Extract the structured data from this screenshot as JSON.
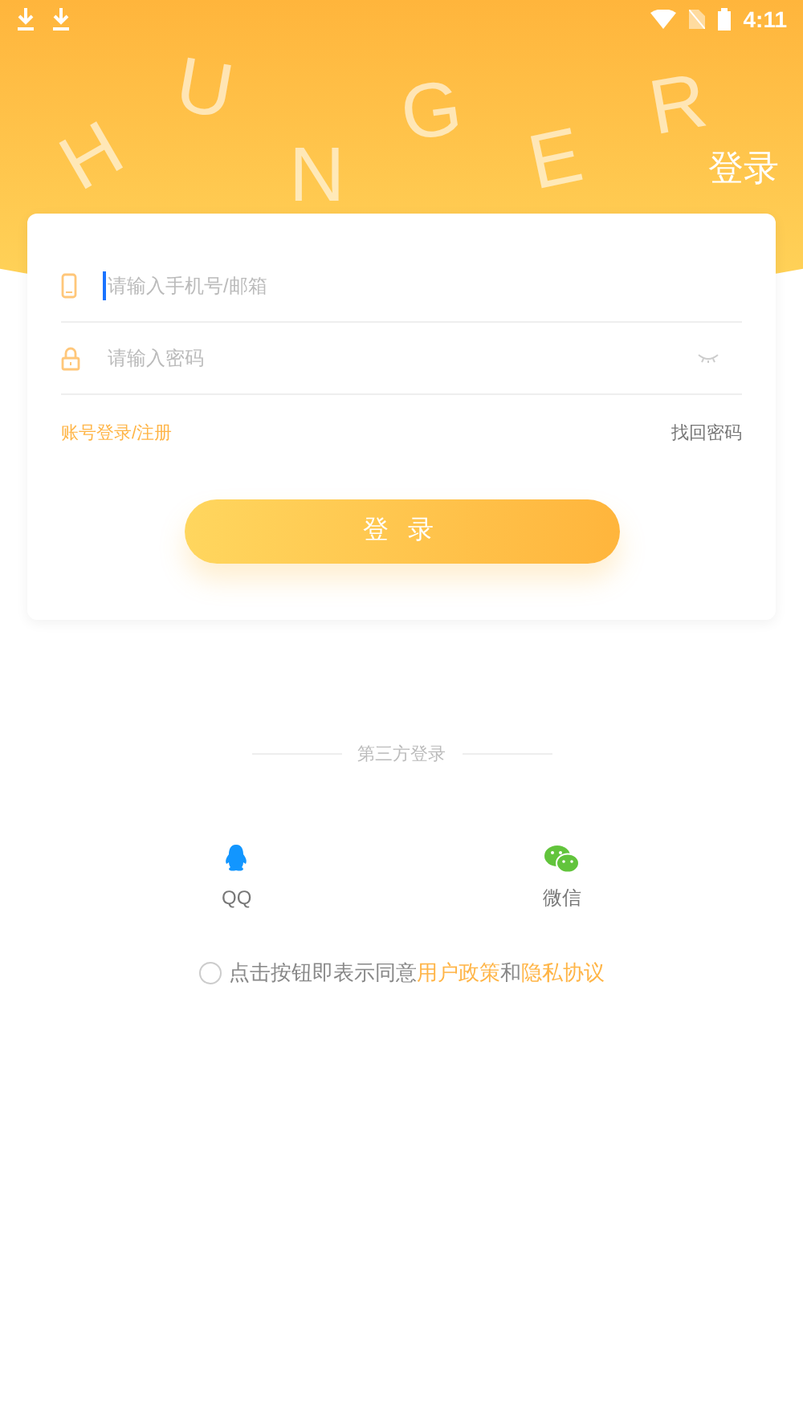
{
  "status_bar": {
    "time": "4:11"
  },
  "header": {
    "title": "登录",
    "decor_letters": [
      "H",
      "U",
      "N",
      "G",
      "E",
      "R"
    ]
  },
  "form": {
    "fields": [
      {
        "kind": "phone",
        "placeholder": "请输入手机号/邮箱",
        "focused": true
      },
      {
        "kind": "password",
        "placeholder": "请输入密码",
        "focused": false
      }
    ],
    "links": [
      {
        "label": "账号登录/注册",
        "kind": "accent"
      },
      {
        "label": "找回密码",
        "kind": "plain"
      }
    ],
    "submit": "登 录"
  },
  "third_party": {
    "title": "第三方登录",
    "options": [
      {
        "kind": "qq",
        "label": "QQ"
      },
      {
        "kind": "wechat",
        "label": "微信"
      }
    ]
  },
  "agreement": {
    "checked": false,
    "text": "点击按钮即表示同意",
    "link_1": "用户政策",
    "joiner": "和",
    "link_2": "隐私协议"
  }
}
